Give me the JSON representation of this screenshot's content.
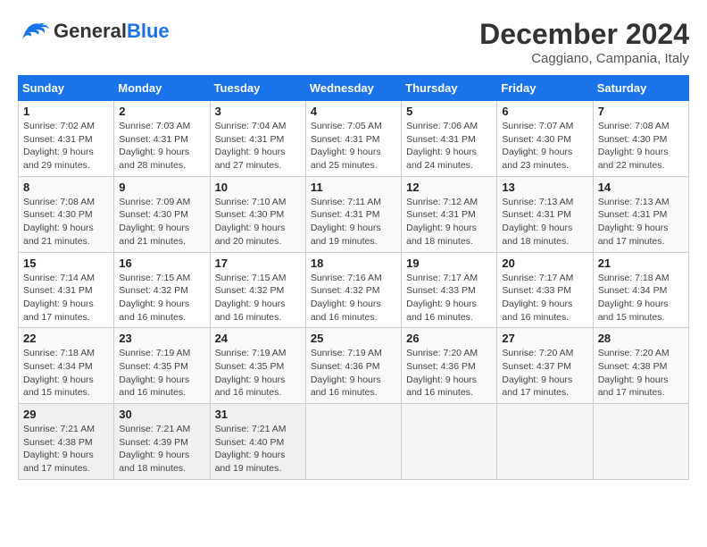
{
  "header": {
    "logo_line1": "General",
    "logo_line2": "Blue",
    "month": "December 2024",
    "location": "Caggiano, Campania, Italy"
  },
  "weekdays": [
    "Sunday",
    "Monday",
    "Tuesday",
    "Wednesday",
    "Thursday",
    "Friday",
    "Saturday"
  ],
  "weeks": [
    [
      {
        "day": "1",
        "sunrise": "7:02 AM",
        "sunset": "4:31 PM",
        "daylight": "9 hours and 29 minutes."
      },
      {
        "day": "2",
        "sunrise": "7:03 AM",
        "sunset": "4:31 PM",
        "daylight": "9 hours and 28 minutes."
      },
      {
        "day": "3",
        "sunrise": "7:04 AM",
        "sunset": "4:31 PM",
        "daylight": "9 hours and 27 minutes."
      },
      {
        "day": "4",
        "sunrise": "7:05 AM",
        "sunset": "4:31 PM",
        "daylight": "9 hours and 25 minutes."
      },
      {
        "day": "5",
        "sunrise": "7:06 AM",
        "sunset": "4:31 PM",
        "daylight": "9 hours and 24 minutes."
      },
      {
        "day": "6",
        "sunrise": "7:07 AM",
        "sunset": "4:30 PM",
        "daylight": "9 hours and 23 minutes."
      },
      {
        "day": "7",
        "sunrise": "7:08 AM",
        "sunset": "4:30 PM",
        "daylight": "9 hours and 22 minutes."
      }
    ],
    [
      {
        "day": "8",
        "sunrise": "7:08 AM",
        "sunset": "4:30 PM",
        "daylight": "9 hours and 21 minutes."
      },
      {
        "day": "9",
        "sunrise": "7:09 AM",
        "sunset": "4:30 PM",
        "daylight": "9 hours and 21 minutes."
      },
      {
        "day": "10",
        "sunrise": "7:10 AM",
        "sunset": "4:30 PM",
        "daylight": "9 hours and 20 minutes."
      },
      {
        "day": "11",
        "sunrise": "7:11 AM",
        "sunset": "4:31 PM",
        "daylight": "9 hours and 19 minutes."
      },
      {
        "day": "12",
        "sunrise": "7:12 AM",
        "sunset": "4:31 PM",
        "daylight": "9 hours and 18 minutes."
      },
      {
        "day": "13",
        "sunrise": "7:13 AM",
        "sunset": "4:31 PM",
        "daylight": "9 hours and 18 minutes."
      },
      {
        "day": "14",
        "sunrise": "7:13 AM",
        "sunset": "4:31 PM",
        "daylight": "9 hours and 17 minutes."
      }
    ],
    [
      {
        "day": "15",
        "sunrise": "7:14 AM",
        "sunset": "4:31 PM",
        "daylight": "9 hours and 17 minutes."
      },
      {
        "day": "16",
        "sunrise": "7:15 AM",
        "sunset": "4:32 PM",
        "daylight": "9 hours and 16 minutes."
      },
      {
        "day": "17",
        "sunrise": "7:15 AM",
        "sunset": "4:32 PM",
        "daylight": "9 hours and 16 minutes."
      },
      {
        "day": "18",
        "sunrise": "7:16 AM",
        "sunset": "4:32 PM",
        "daylight": "9 hours and 16 minutes."
      },
      {
        "day": "19",
        "sunrise": "7:17 AM",
        "sunset": "4:33 PM",
        "daylight": "9 hours and 16 minutes."
      },
      {
        "day": "20",
        "sunrise": "7:17 AM",
        "sunset": "4:33 PM",
        "daylight": "9 hours and 16 minutes."
      },
      {
        "day": "21",
        "sunrise": "7:18 AM",
        "sunset": "4:34 PM",
        "daylight": "9 hours and 15 minutes."
      }
    ],
    [
      {
        "day": "22",
        "sunrise": "7:18 AM",
        "sunset": "4:34 PM",
        "daylight": "9 hours and 15 minutes."
      },
      {
        "day": "23",
        "sunrise": "7:19 AM",
        "sunset": "4:35 PM",
        "daylight": "9 hours and 16 minutes."
      },
      {
        "day": "24",
        "sunrise": "7:19 AM",
        "sunset": "4:35 PM",
        "daylight": "9 hours and 16 minutes."
      },
      {
        "day": "25",
        "sunrise": "7:19 AM",
        "sunset": "4:36 PM",
        "daylight": "9 hours and 16 minutes."
      },
      {
        "day": "26",
        "sunrise": "7:20 AM",
        "sunset": "4:36 PM",
        "daylight": "9 hours and 16 minutes."
      },
      {
        "day": "27",
        "sunrise": "7:20 AM",
        "sunset": "4:37 PM",
        "daylight": "9 hours and 17 minutes."
      },
      {
        "day": "28",
        "sunrise": "7:20 AM",
        "sunset": "4:38 PM",
        "daylight": "9 hours and 17 minutes."
      }
    ],
    [
      {
        "day": "29",
        "sunrise": "7:21 AM",
        "sunset": "4:38 PM",
        "daylight": "9 hours and 17 minutes."
      },
      {
        "day": "30",
        "sunrise": "7:21 AM",
        "sunset": "4:39 PM",
        "daylight": "9 hours and 18 minutes."
      },
      {
        "day": "31",
        "sunrise": "7:21 AM",
        "sunset": "4:40 PM",
        "daylight": "9 hours and 19 minutes."
      },
      null,
      null,
      null,
      null
    ]
  ]
}
